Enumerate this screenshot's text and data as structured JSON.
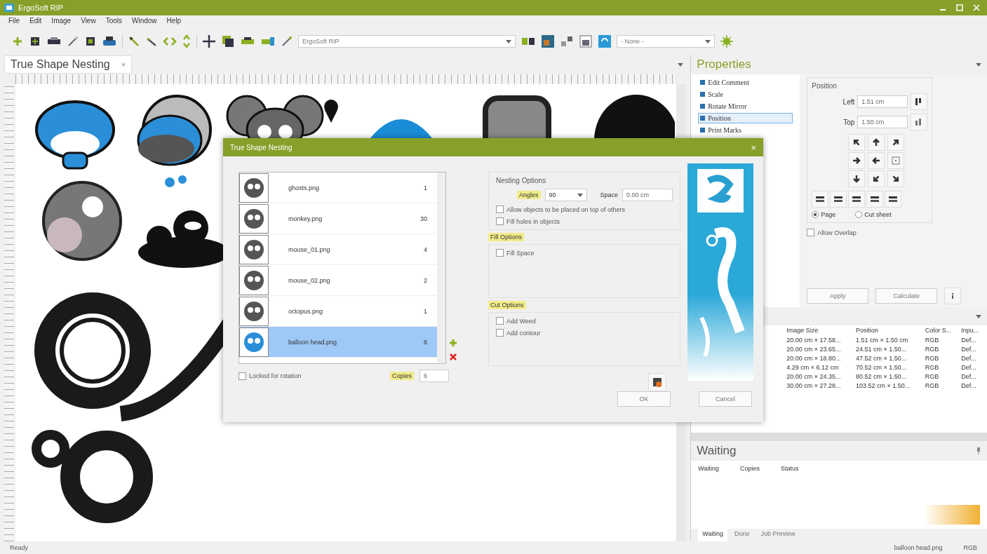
{
  "window": {
    "title": "ErgoSoft RIP"
  },
  "menu": [
    "File",
    "Edit",
    "Image",
    "View",
    "Tools",
    "Window",
    "Help"
  ],
  "toolbar": {
    "printer_combo": "ErgoSoft RIP",
    "preset_combo": "- None -"
  },
  "document_tab": {
    "title": "True Shape Nesting",
    "close": "×"
  },
  "properties": {
    "title": "Properties",
    "tree": [
      {
        "label": "Edit Comment",
        "selected": false
      },
      {
        "label": "Scale",
        "selected": false
      },
      {
        "label": "Rotate Mirror",
        "selected": false
      },
      {
        "label": "Position",
        "selected": true
      },
      {
        "label": "Print Marks",
        "selected": false
      }
    ],
    "position": {
      "title": "Position",
      "left_label": "Left",
      "left_value": "1.51 cm",
      "top_label": "Top",
      "top_value": "1.50 cm",
      "reference": [
        {
          "label": "Page",
          "selected": true
        },
        {
          "label": "Cut sheet",
          "selected": false
        }
      ]
    },
    "allow_overlap": {
      "label": "Allow Overlap",
      "checked": false
    },
    "buttons": [
      "Apply",
      "Calculate"
    ]
  },
  "images_table": {
    "columns": [
      "Image Size",
      "Position",
      "Color S...",
      "Inpu..."
    ],
    "rows": [
      [
        "20.00 cm × 17.58...",
        "1.51 cm × 1.50 cm",
        "RGB",
        "Def..."
      ],
      [
        "20.00 cm × 23.65...",
        "24.51 cm × 1.50...",
        "RGB",
        "Def..."
      ],
      [
        "20.00 cm × 18.80...",
        "47.52 cm × 1.50...",
        "RGB",
        "Def..."
      ],
      [
        "4.29 cm × 6.12 cm",
        "70.52 cm × 1.50...",
        "RGB",
        "Def..."
      ],
      [
        "20.00 cm × 24.35...",
        "80.52 cm × 1.50...",
        "RGB",
        "Def..."
      ],
      [
        "30.00 cm × 27.28...",
        "103.52 cm × 1.50...",
        "RGB",
        "Def..."
      ]
    ]
  },
  "waiting": {
    "title": "Waiting",
    "columns": [
      "Waiting",
      "Copies",
      "Status"
    ],
    "tabs": [
      {
        "label": "Waiting",
        "selected": true
      },
      {
        "label": "Done",
        "selected": false
      },
      {
        "label": "Job Preview",
        "selected": false
      }
    ]
  },
  "status_bar": {
    "left": "Ready",
    "file": "balloon head.png",
    "color_mode": "RGB"
  },
  "dialog": {
    "title": "True Shape Nesting",
    "close": "×",
    "images": [
      {
        "name": "ghosts.png",
        "copies": "1",
        "selected": false
      },
      {
        "name": "monkey.png",
        "copies": "30",
        "selected": false
      },
      {
        "name": "mouse_01.png",
        "copies": "4",
        "selected": false
      },
      {
        "name": "mouse_02.png",
        "copies": "2",
        "selected": false
      },
      {
        "name": "octopus.png",
        "copies": "1",
        "selected": false
      },
      {
        "name": "balloon head.png",
        "copies": "6",
        "selected": true
      }
    ],
    "locked_rotation": {
      "label": "Locked for rotation",
      "checked": false
    },
    "copies_label": "Copies",
    "copies_value": "6",
    "nesting_options": {
      "title": "Nesting Options",
      "angles_label": "Angles",
      "angles_value": "90",
      "space_label": "Space",
      "space_value": "0.00 cm",
      "options": [
        {
          "label": "Allow objects to be placed on top of others",
          "checked": false
        },
        {
          "label": "Fill holes in objects",
          "checked": false
        }
      ]
    },
    "fill_options": {
      "title": "Fill Options",
      "options": [
        {
          "label": "Fill Space",
          "checked": false
        }
      ]
    },
    "cut_options": {
      "title": "Cut Options",
      "options": [
        {
          "label": "Add Weed",
          "checked": false
        },
        {
          "label": "Add contour",
          "checked": false
        }
      ]
    },
    "buttons": [
      "OK",
      "Cancel"
    ]
  }
}
